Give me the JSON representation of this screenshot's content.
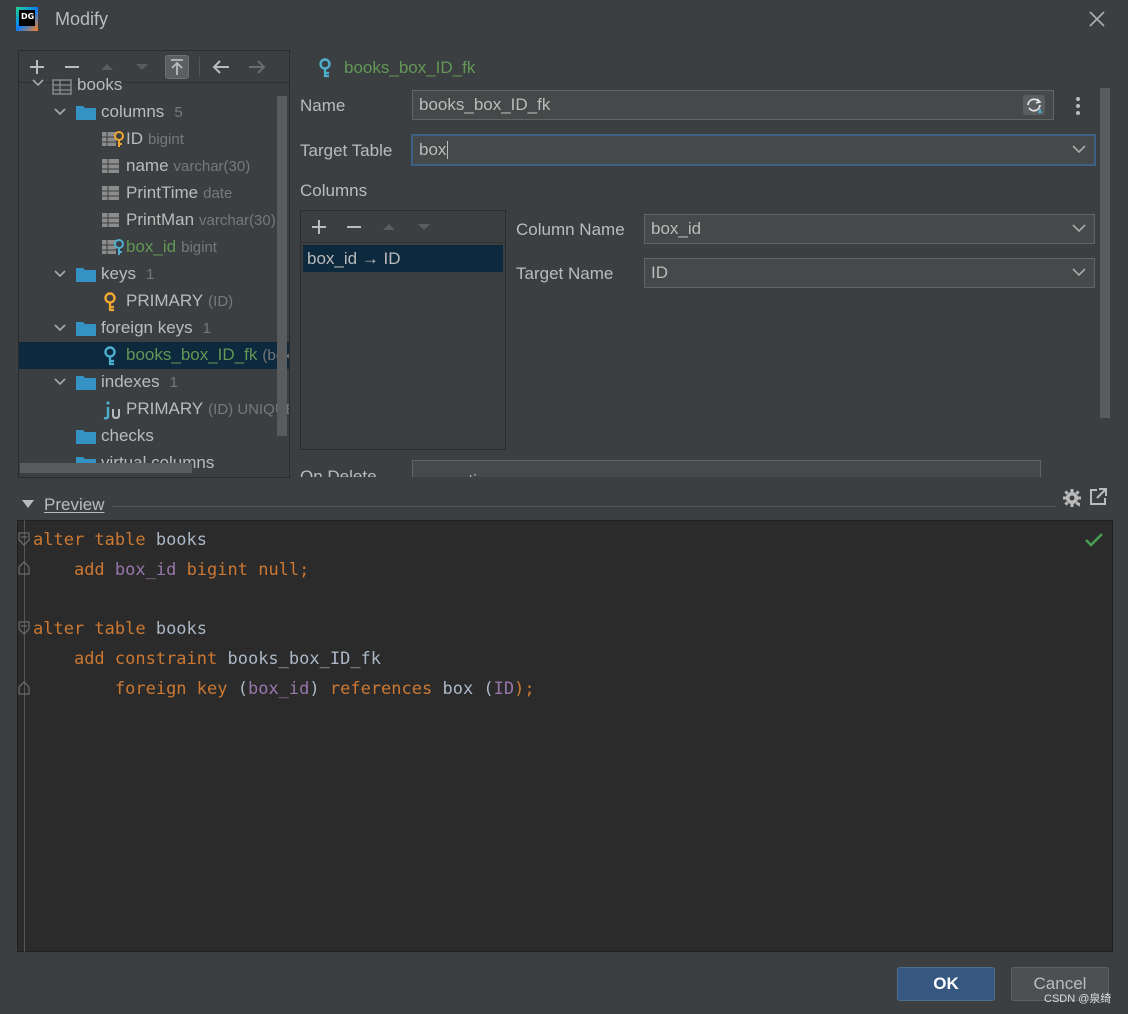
{
  "window": {
    "title": "Modify"
  },
  "tree": {
    "items": [
      {
        "label": "books",
        "kind": "table"
      },
      {
        "label": "columns",
        "count": "5",
        "kind": "folder"
      },
      {
        "label": "ID",
        "meta": "bigint",
        "kind": "pk-fk-column"
      },
      {
        "label": "name",
        "meta": "varchar(30)",
        "kind": "column"
      },
      {
        "label": "PrintTime",
        "meta": "date",
        "kind": "column"
      },
      {
        "label": "PrintMan",
        "meta": "varchar(30)",
        "kind": "column"
      },
      {
        "label": "box_id",
        "meta": "bigint",
        "kind": "fk-column"
      },
      {
        "label": "keys",
        "count": "1",
        "kind": "folder"
      },
      {
        "label": "PRIMARY",
        "meta": "(ID)",
        "kind": "key"
      },
      {
        "label": "foreign keys",
        "count": "1",
        "kind": "folder"
      },
      {
        "label": "books_box_ID_fk",
        "meta": "(box",
        "kind": "foreign-key"
      },
      {
        "label": "indexes",
        "count": "1",
        "kind": "folder"
      },
      {
        "label": "PRIMARY",
        "meta": "(ID) UNIQUE",
        "kind": "index"
      },
      {
        "label": "checks",
        "kind": "folder"
      },
      {
        "label": "virtual columns",
        "kind": "folder"
      }
    ]
  },
  "form": {
    "header": "books_box_ID_fk",
    "name_label": "Name",
    "name_value": "books_box_ID_fk",
    "target_table_label": "Target Table",
    "target_table_value": "box",
    "columns_label": "Columns",
    "column_mapping": "box_id → ID",
    "column_name_label": "Column Name",
    "column_name_value": "box_id",
    "target_name_label": "Target Name",
    "target_name_value": "ID",
    "on_delete_label": "On Delete",
    "on_delete_value": "no_action"
  },
  "preview": {
    "title": "Preview",
    "code": [
      {
        "kw1": "alter table",
        "t1": " books"
      },
      {
        "indent": "    ",
        "kw1": "add",
        "col": " box_id",
        "kw2": " bigint null;"
      },
      {
        "blank": true
      },
      {
        "kw1": "alter table",
        "t1": " books"
      },
      {
        "indent": "    ",
        "kw1": "add constraint",
        "t1": " books_box_ID_fk"
      },
      {
        "indent": "        ",
        "kw1": "foreign key",
        "t1": " (",
        "col": "box_id",
        "t2": ")",
        "kw2": " references",
        "t3": " box (",
        "col2": "ID",
        "t4": ");"
      }
    ]
  },
  "buttons": {
    "ok": "OK",
    "cancel": "Cancel"
  },
  "watermark": "CSDN @泉绮",
  "colors": {
    "background": "#3c3f41",
    "editor_bg": "#2b2b2b",
    "keyword": "#cc7832",
    "column_ref": "#9876aa",
    "fk_green": "#629755",
    "selection": "#0d293e",
    "primary_button": "#365880"
  }
}
